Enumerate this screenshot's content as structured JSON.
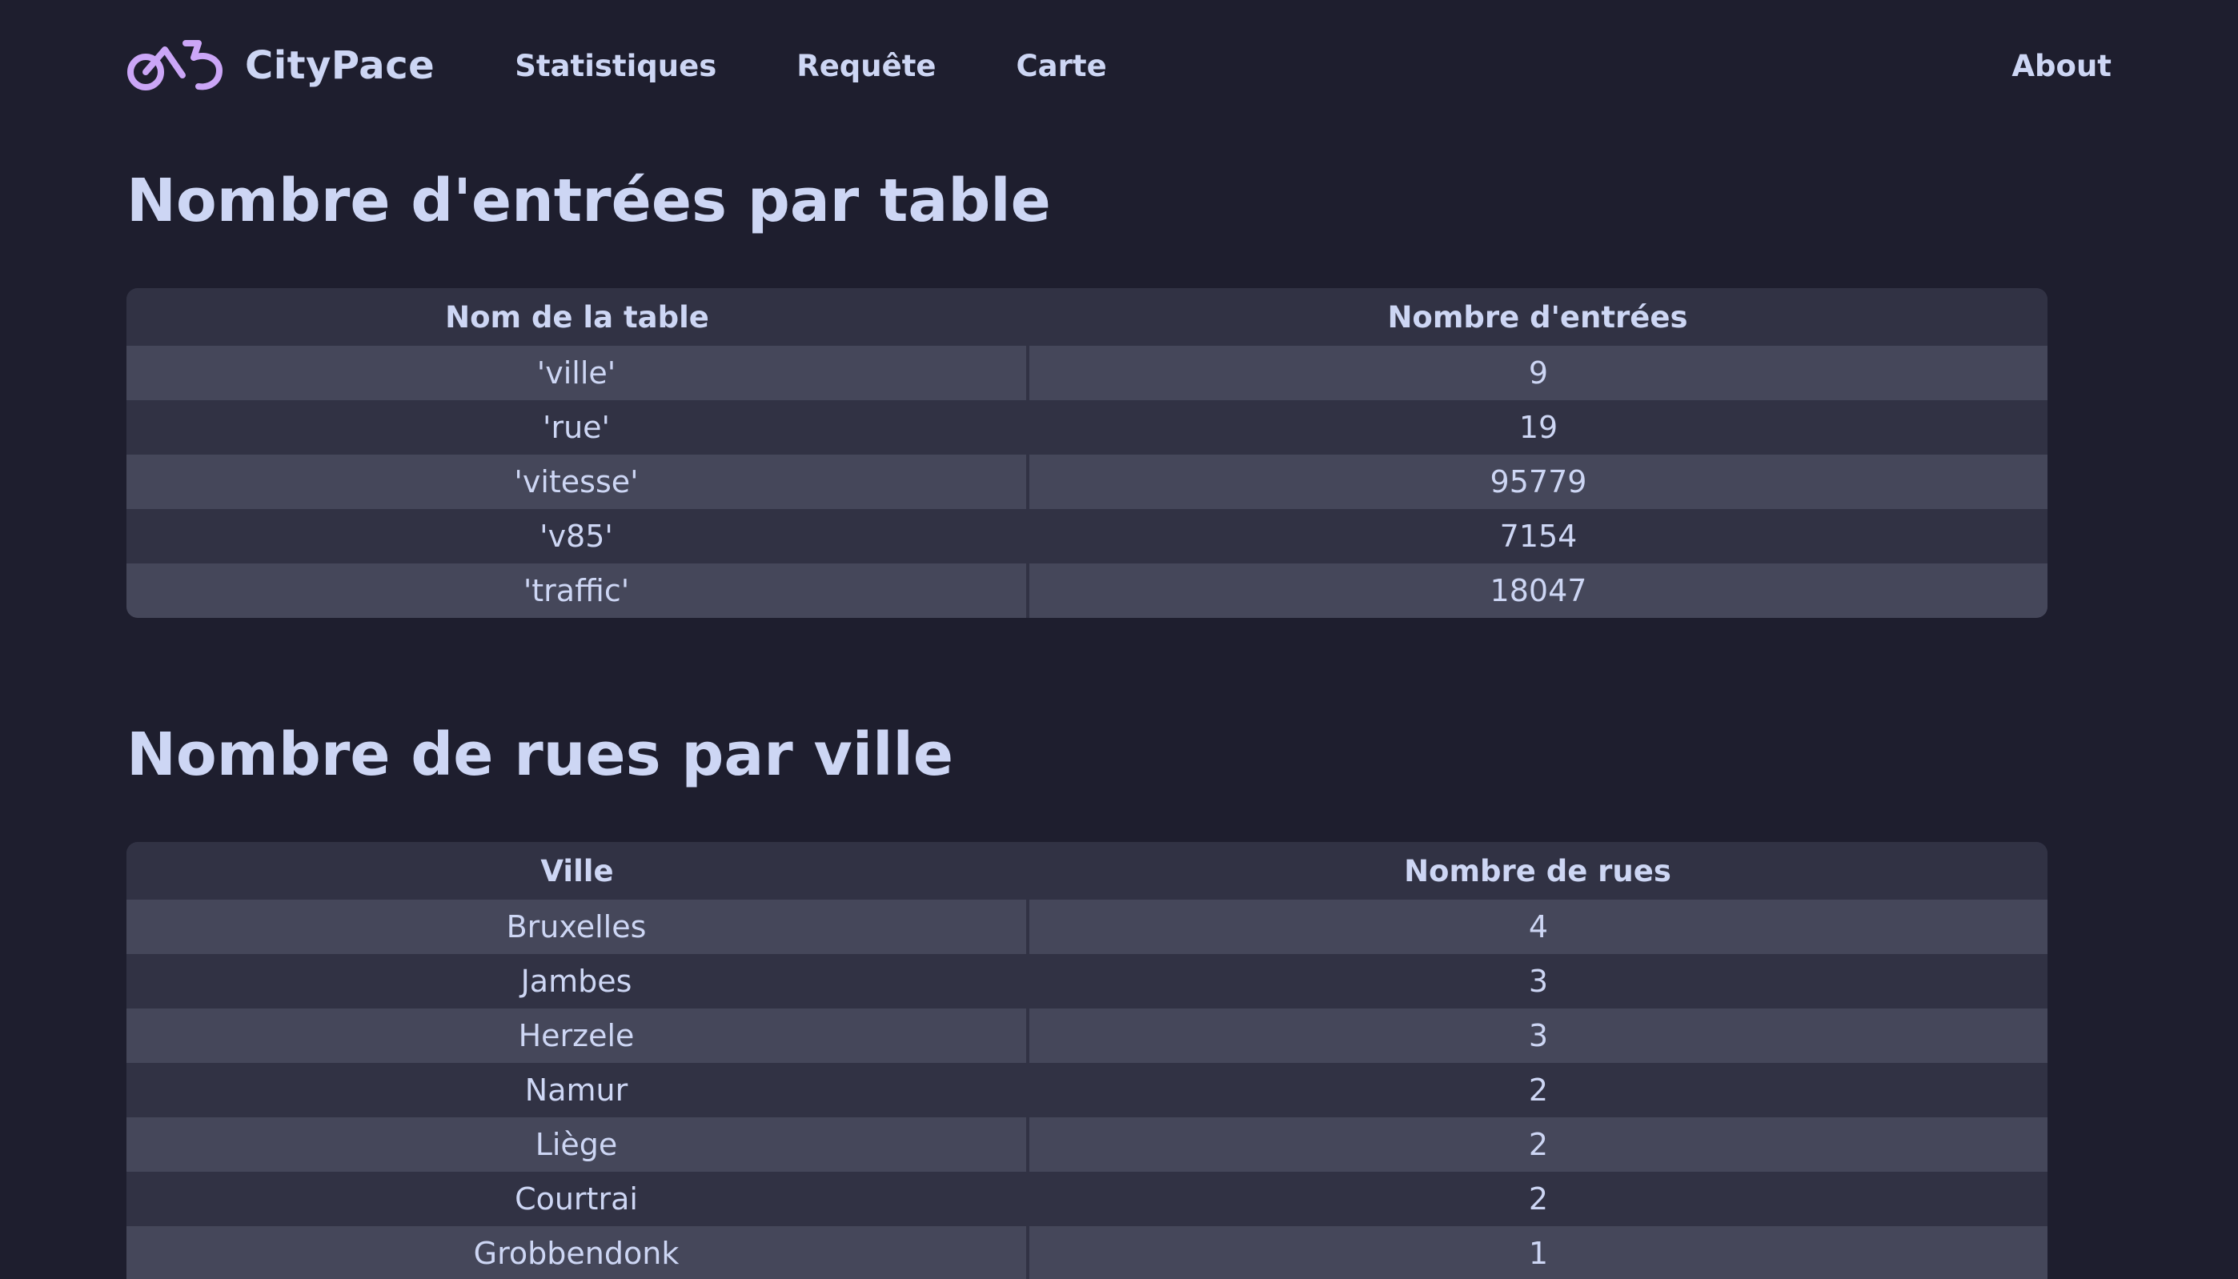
{
  "navbar": {
    "brand_name": "CityPace",
    "links": [
      "Statistiques",
      "Requête",
      "Carte"
    ],
    "about": "About"
  },
  "colors": {
    "background": "#1e1e2e",
    "surface": "#313244",
    "row_alt": "#45475a",
    "text": "#cdd6f4",
    "logo_accent": "#cba6f7"
  },
  "section1": {
    "title": "Nombre d'entrées par table",
    "headers": [
      "Nom de la table",
      "Nombre d'entrées"
    ],
    "rows": [
      [
        "'ville'",
        "9"
      ],
      [
        "'rue'",
        "19"
      ],
      [
        "'vitesse'",
        "95779"
      ],
      [
        "'v85'",
        "7154"
      ],
      [
        "'traffic'",
        "18047"
      ]
    ]
  },
  "section2": {
    "title": "Nombre de rues par ville",
    "headers": [
      "Ville",
      "Nombre de rues"
    ],
    "rows": [
      [
        "Bruxelles",
        "4"
      ],
      [
        "Jambes",
        "3"
      ],
      [
        "Herzele",
        "3"
      ],
      [
        "Namur",
        "2"
      ],
      [
        "Liège",
        "2"
      ],
      [
        "Courtrai",
        "2"
      ],
      [
        "Grobbendonk",
        "1"
      ]
    ]
  }
}
